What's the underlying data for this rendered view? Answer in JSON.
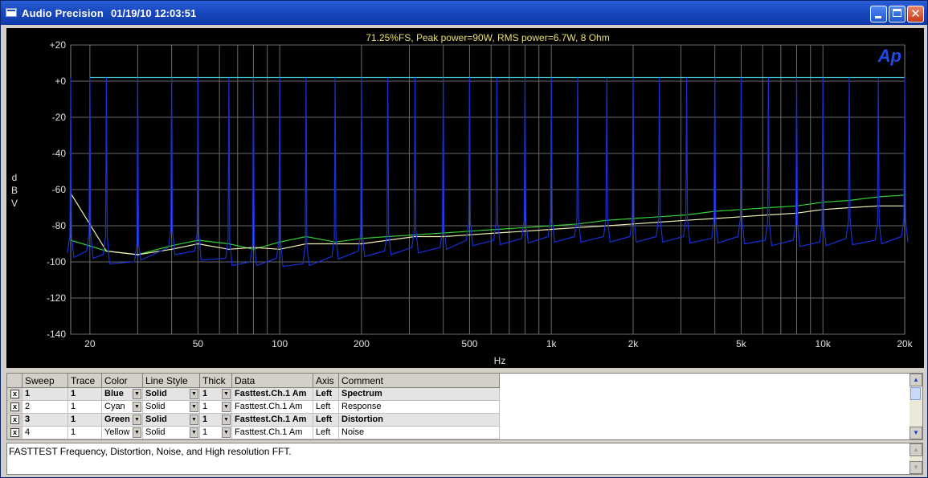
{
  "window": {
    "title": "Audio Precision",
    "datetime": "01/19/10 12:03:51",
    "minimize_label": "_",
    "maximize_label": "□",
    "close_label": "✕"
  },
  "chart_data": {
    "type": "line",
    "title": "71.25%FS, Peak power=90W, RMS power=6.7W, 8 Ohm",
    "xlabel": "Hz",
    "ylabel": "d B V",
    "x_scale": "log",
    "xlim": [
      17,
      20000
    ],
    "ylim": [
      -140,
      20
    ],
    "grid": true,
    "logo": "Ap",
    "x_ticks": [
      20,
      50,
      100,
      200,
      500,
      1000,
      2000,
      5000,
      10000,
      20000
    ],
    "x_tick_labels": [
      "20",
      "50",
      "100",
      "200",
      "500",
      "1k",
      "2k",
      "5k",
      "10k",
      "20k"
    ],
    "y_ticks": [
      20,
      0,
      -20,
      -40,
      -60,
      -80,
      -100,
      -120,
      -140
    ],
    "y_tick_labels": [
      "+20",
      "+0",
      "-20",
      "-40",
      "-60",
      "-80",
      "-100",
      "-120",
      "-140"
    ],
    "series": [
      {
        "name": "Response",
        "color": "#40c0d0",
        "x": [
          20,
          20000
        ],
        "y": [
          2,
          2
        ]
      },
      {
        "name": "Distortion",
        "color": "#30d030",
        "x": [
          17,
          23,
          30,
          40,
          50,
          65,
          80,
          100,
          125,
          160,
          200,
          250,
          315,
          400,
          500,
          630,
          800,
          1000,
          1250,
          1600,
          2000,
          2500,
          3150,
          4000,
          5000,
          6300,
          8000,
          10000,
          12500,
          16000,
          20000
        ],
        "y": [
          -88,
          -94,
          -96,
          -91,
          -88,
          -90,
          -93,
          -89,
          -86,
          -89,
          -87,
          -86,
          -85,
          -84,
          -83,
          -82,
          -81,
          -80,
          -79,
          -77,
          -76,
          -75,
          -74,
          -72,
          -71,
          -70,
          -69,
          -67,
          -66,
          -64,
          -63
        ]
      },
      {
        "name": "Noise",
        "color": "#f0f0b0",
        "x": [
          17,
          23,
          30,
          40,
          50,
          65,
          80,
          100,
          125,
          160,
          200,
          250,
          315,
          400,
          500,
          630,
          800,
          1000,
          1250,
          1600,
          2000,
          2500,
          3150,
          4000,
          5000,
          6300,
          8000,
          10000,
          12500,
          16000,
          20000
        ],
        "y": [
          -62,
          -94,
          -96,
          -93,
          -90,
          -93,
          -92,
          -93,
          -90,
          -90,
          -90,
          -88,
          -86,
          -86,
          -85,
          -84,
          -83,
          -82,
          -81,
          -80,
          -79,
          -78,
          -77,
          -76,
          -75,
          -74,
          -73,
          -71,
          -70,
          -69,
          -69
        ]
      },
      {
        "name": "Spectrum",
        "color": "#1830d8",
        "x": [
          17,
          20,
          23,
          30,
          40,
          50,
          65,
          80,
          100,
          125,
          160,
          200,
          250,
          315,
          400,
          500,
          630,
          800,
          1000,
          1250,
          1600,
          2000,
          2500,
          3150,
          4000,
          5000,
          6300,
          8000,
          10000,
          12500,
          16000,
          20000
        ],
        "peaks": [
          2,
          2,
          2,
          2,
          2,
          2,
          2,
          2,
          2,
          2,
          2,
          2,
          2,
          2,
          2,
          2,
          2,
          2,
          2,
          2,
          2,
          2,
          2,
          2,
          2,
          2,
          2,
          2,
          2,
          2,
          2,
          2
        ],
        "floor": [
          -95,
          -94,
          -96,
          -100,
          -92,
          -94,
          -98,
          -100,
          -98,
          -101,
          -97,
          -94,
          -94,
          -92,
          -92,
          -88,
          -88,
          -87,
          -86,
          -86,
          -86,
          -86,
          -86,
          -86,
          -87,
          -86,
          -88,
          -88,
          -89,
          -87,
          -88,
          -86
        ]
      }
    ]
  },
  "table": {
    "columns": [
      "Sweep",
      "Trace",
      "Color",
      "Line Style",
      "Thick",
      "Data",
      "Axis",
      "Comment"
    ],
    "rows": [
      {
        "sweep": "1",
        "trace": "1",
        "color": "Blue",
        "style": "Solid",
        "thick": "1",
        "data": "Fasttest.Ch.1 Am",
        "axis": "Left",
        "comment": "Spectrum"
      },
      {
        "sweep": "2",
        "trace": "1",
        "color": "Cyan",
        "style": "Solid",
        "thick": "1",
        "data": "Fasttest.Ch.1 Am",
        "axis": "Left",
        "comment": "Response"
      },
      {
        "sweep": "3",
        "trace": "1",
        "color": "Green",
        "style": "Solid",
        "thick": "1",
        "data": "Fasttest.Ch.1 Am",
        "axis": "Left",
        "comment": "Distortion"
      },
      {
        "sweep": "4",
        "trace": "1",
        "color": "Yellow",
        "style": "Solid",
        "thick": "1",
        "data": "Fasttest.Ch.1 Am",
        "axis": "Left",
        "comment": "Noise"
      }
    ],
    "checkbox_mark": "x",
    "dropdown_glyph": "▼"
  },
  "comment_text": "FASTTEST Frequency, Distortion, Noise, and High resolution FFT.",
  "scroll": {
    "up": "▲",
    "down": "▼"
  }
}
